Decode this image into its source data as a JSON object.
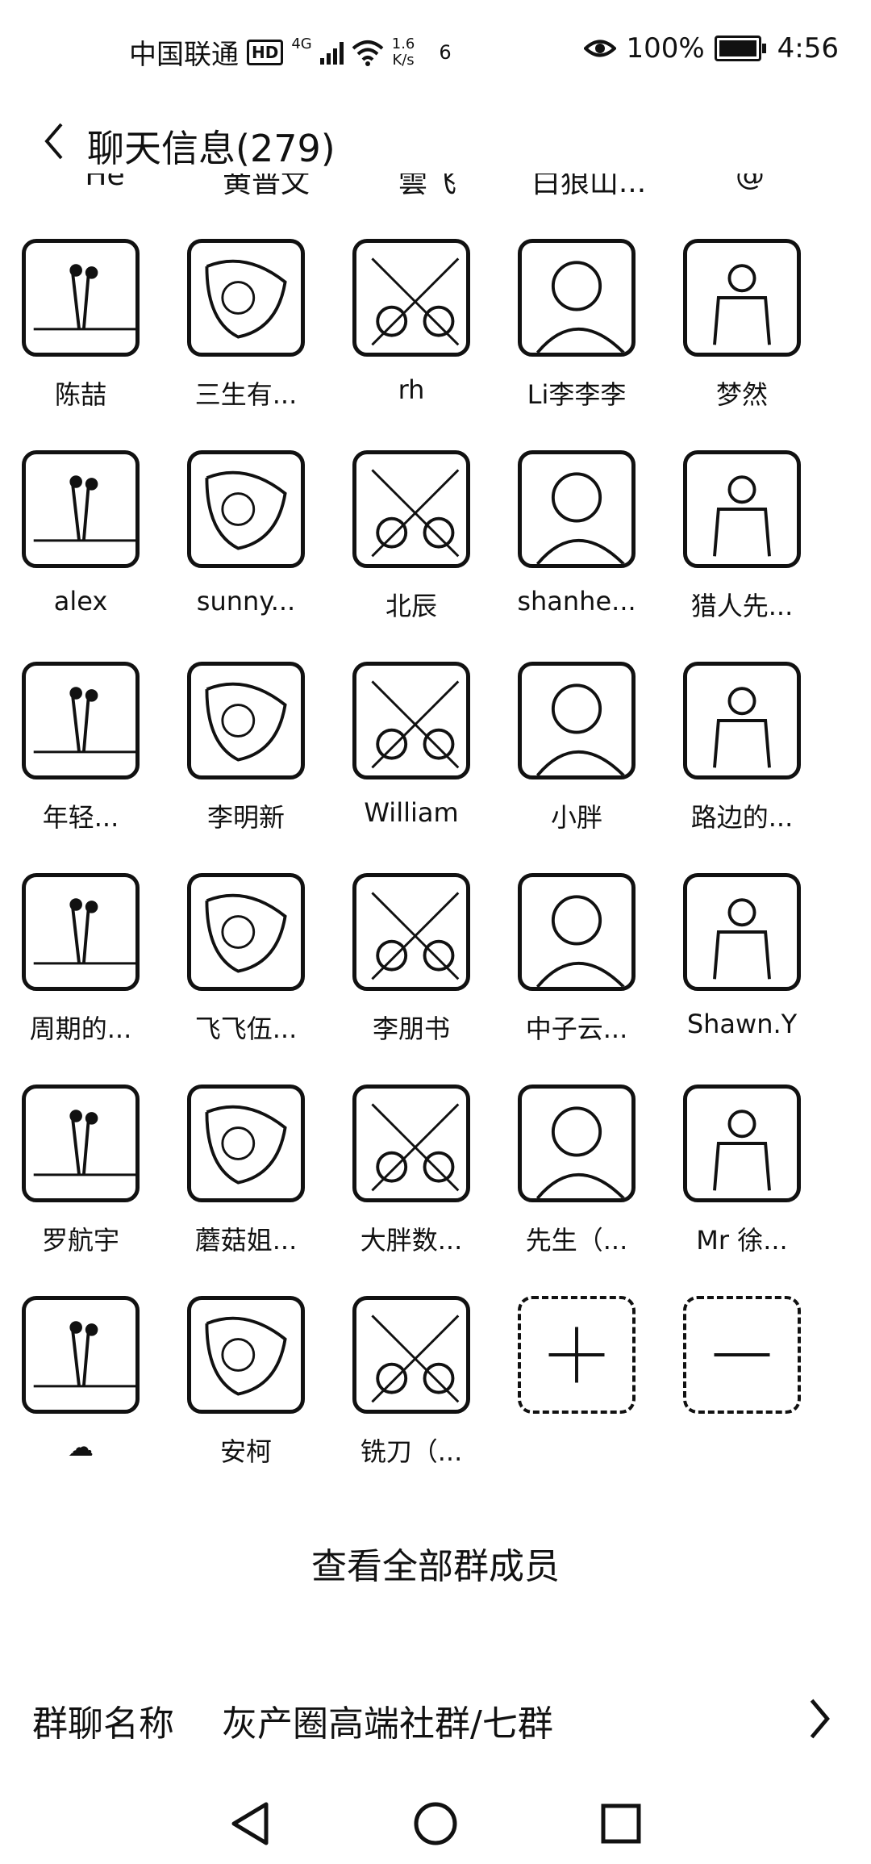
{
  "status_bar": {
    "carrier": "中国联通",
    "hd": "HD",
    "network": "4G",
    "speed_value": "1.6",
    "speed_unit": "K/s",
    "notification_count": "6",
    "battery": "100%",
    "time": "4:56"
  },
  "header": {
    "title": "聊天信息(279)"
  },
  "clipped_row": [
    "He",
    "黄普文",
    "雲飞",
    "白狼山...",
    "@"
  ],
  "members": [
    {
      "name": "陈喆"
    },
    {
      "name": "三生有..."
    },
    {
      "name": "rh"
    },
    {
      "name": "Li李李李"
    },
    {
      "name": "梦然"
    },
    {
      "name": "alex"
    },
    {
      "name": "sunny..."
    },
    {
      "name": "北辰"
    },
    {
      "name": "shanhe..."
    },
    {
      "name": "猎人先..."
    },
    {
      "name": "年轻..."
    },
    {
      "name": "李明新"
    },
    {
      "name": "William"
    },
    {
      "name": "小胖"
    },
    {
      "name": "路边的..."
    },
    {
      "name": "周期的..."
    },
    {
      "name": "飞飞伍..."
    },
    {
      "name": "李朋书"
    },
    {
      "name": "中子云..."
    },
    {
      "name": "Shawn.Y"
    },
    {
      "name": "罗航宇"
    },
    {
      "name": "蘑菇姐..."
    },
    {
      "name": "大胖数..."
    },
    {
      "name": "先生（..."
    },
    {
      "name": "Mr 徐..."
    },
    {
      "name": "☁"
    },
    {
      "name": "安柯"
    },
    {
      "name": "铣刀（..."
    }
  ],
  "add_member_label": "+",
  "remove_member_label": "−",
  "view_all": "查看全部群成员",
  "group_name": {
    "label": "群聊名称",
    "value": "灰产圈高端社群/七群"
  }
}
